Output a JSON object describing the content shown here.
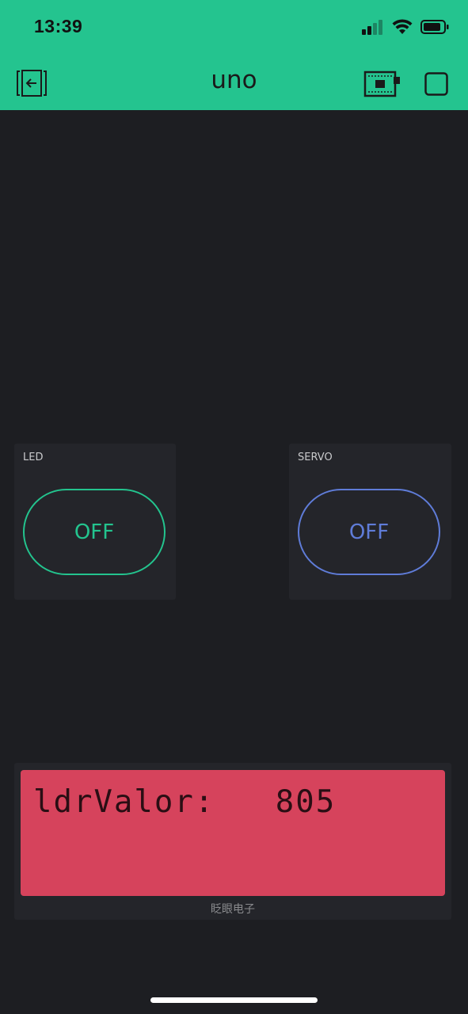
{
  "status_bar": {
    "time": "13:39"
  },
  "header": {
    "title": "uno",
    "background": "#24c48f"
  },
  "widgets": {
    "led": {
      "label": "LED",
      "button_text": "OFF",
      "color": "#23c48e"
    },
    "servo": {
      "label": "SERVO",
      "button_text": "OFF",
      "color": "#5f7cd8"
    }
  },
  "lcd": {
    "line1": "ldrValor:   805",
    "line2": "",
    "caption": "眨眼电子",
    "background": "#d6435c"
  },
  "icons": {
    "back": "exit-project-icon",
    "device": "device-board-icon",
    "play": "stop-square-icon"
  }
}
